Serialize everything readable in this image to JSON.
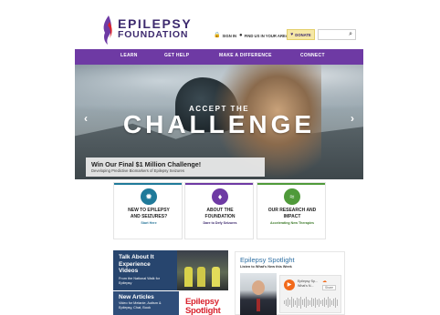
{
  "logo": {
    "line1": "EPILEPSY",
    "line2": "FOUNDATION",
    "icon": "flame-logo"
  },
  "utility": {
    "sign_in": "SIGN IN",
    "find_us": "FIND US IN YOUR AREA",
    "donate": "DONATE",
    "search_placeholder": ""
  },
  "nav": {
    "items": [
      "LEARN",
      "GET HELP",
      "MAKE A DIFFERENCE",
      "CONNECT"
    ]
  },
  "hero": {
    "accept": "ACCEPT THE",
    "challenge": "CHALLENGE",
    "caption_title": "Win Our Final $1 Million Challenge!",
    "caption_sub": "Developing Predictive Biomarkers of Epilepsy Seizures"
  },
  "cards": [
    {
      "title_1": "NEW TO EPILEPSY",
      "title_2": "AND SEIZURES?",
      "link": "Start Here",
      "icon": "sparkle-icon",
      "color": "#1f7a9a"
    },
    {
      "title_1": "ABOUT THE",
      "title_2": "FOUNDATION",
      "link": "Dare to Defy Seizures",
      "icon": "flame-icon",
      "color": "#6e3aa4"
    },
    {
      "title_1": "OUR RESEARCH AND",
      "title_2": "IMPACT",
      "link": "Accelerating New Therapies",
      "icon": "dna-icon",
      "color": "#4f9a3a"
    }
  ],
  "video_tile": {
    "title_1": "Talk About It",
    "title_2": "Experience Videos",
    "sub": "From the National Walk for Epilepsy"
  },
  "articles_tile": {
    "title": "New Articles",
    "sub": "Video for Melanie, Autism & Epilepsy, Chat, Book"
  },
  "magazine_tile": {
    "title_1": "Epilepsy",
    "title_2": "Spotlight"
  },
  "spotlight": {
    "heading": "Epilepsy Spotlight",
    "sub": "Listen to What's New this Week",
    "track": "Epilepsy Sp... What's N...",
    "share": "Share"
  }
}
